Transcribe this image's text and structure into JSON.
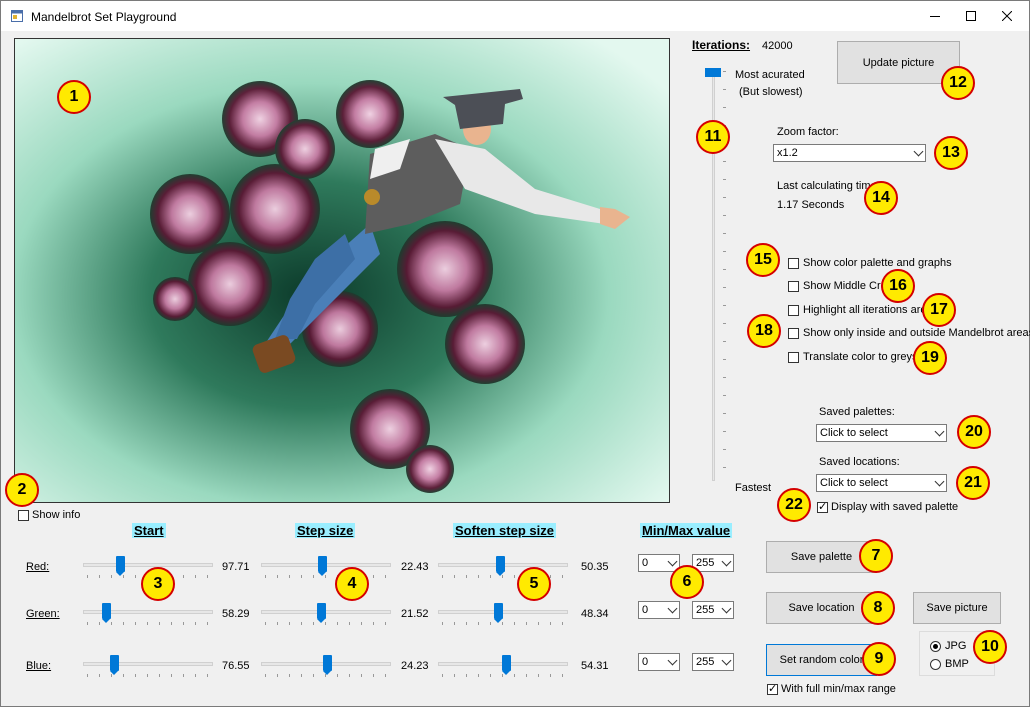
{
  "window": {
    "title": "Mandelbrot Set Playground"
  },
  "iterations": {
    "label": "Iterations:",
    "value": "42000",
    "top_label": "Most acurated",
    "top_sub": "(But slowest)",
    "bottom_label": "Fastest",
    "level_fraction": 0.0
  },
  "buttons": {
    "update": "Update picture",
    "save_palette": "Save  palette",
    "save_location": "Save location",
    "save_picture": "Save picture",
    "random_color": "Set random color"
  },
  "zoom": {
    "label": "Zoom factor:",
    "value": "x1.2"
  },
  "calc": {
    "label": "Last calculating time:",
    "value": "1.17 Seconds"
  },
  "options": [
    {
      "label": "Show color palette and graphs",
      "checked": false
    },
    {
      "label": "Show Middle Cross",
      "checked": false
    },
    {
      "label": "Highlight all iterations areas",
      "checked": false
    },
    {
      "label": "Show only inside and outside Mandelbrot areas",
      "checked": false
    },
    {
      "label": "Translate color to greyscale",
      "checked": false
    }
  ],
  "saved_palettes": {
    "label": "Saved palettes:",
    "value": "Click to select"
  },
  "saved_locations": {
    "label": "Saved locations:",
    "value": "Click to select"
  },
  "display_saved_palette": {
    "label": "Display with saved palette",
    "checked": true
  },
  "show_info": {
    "label": "Show info",
    "checked": false
  },
  "headers": {
    "start": "Start",
    "step": "Step size",
    "soften": "Soften step size",
    "minmax": "Min/Max value"
  },
  "channels": [
    {
      "name": "Red:",
      "start": "97.71",
      "step": "22.43",
      "soften": "50.35",
      "min": "0",
      "max": "255",
      "start_frac": 0.27,
      "step_frac": 0.47,
      "soften_frac": 0.48
    },
    {
      "name": "Green:",
      "start": "58.29",
      "step": "21.52",
      "soften": "48.34",
      "min": "0",
      "max": "255",
      "start_frac": 0.16,
      "step_frac": 0.46,
      "soften_frac": 0.46
    },
    {
      "name": "Blue:",
      "start": "76.55",
      "step": "24.23",
      "soften": "54.31",
      "min": "0",
      "max": "255",
      "start_frac": 0.22,
      "step_frac": 0.51,
      "soften_frac": 0.53
    }
  ],
  "full_range": {
    "label": "With full min/max range",
    "checked": true
  },
  "format": {
    "jpg": "JPG",
    "bmp": "BMP",
    "selected": "JPG"
  },
  "badges": [
    "1",
    "2",
    "3",
    "4",
    "5",
    "6",
    "7",
    "8",
    "9",
    "10",
    "11",
    "12",
    "13",
    "14",
    "15",
    "16",
    "17",
    "18",
    "19",
    "20",
    "21",
    "22"
  ],
  "colors": {
    "badge_fill": "#ffea00",
    "badge_border": "#d40000",
    "header_bg": "#99eeff",
    "accent": "#0078d7",
    "fractal_bg": "#d3f1e6",
    "fractal_pink": "#c77aa3"
  }
}
